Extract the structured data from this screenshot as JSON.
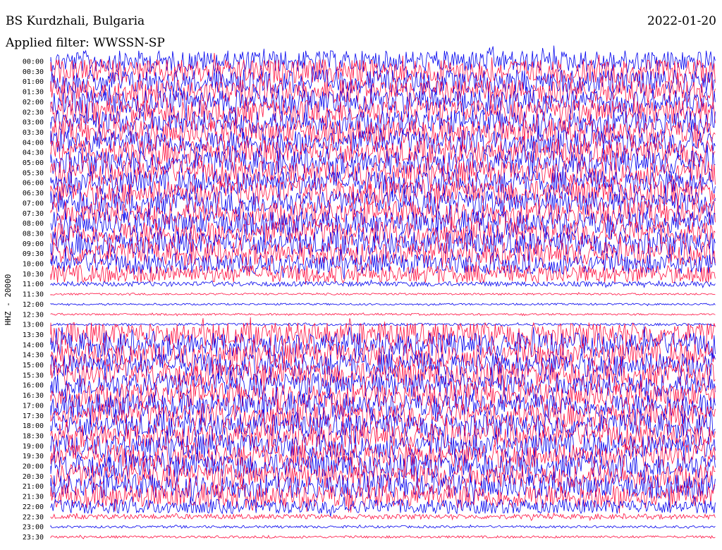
{
  "header": {
    "station": "BS Kurdzhali, Bulgaria",
    "date": "2022-01-20",
    "filter": "Applied filter: WWSSN-SP"
  },
  "chart_data": {
    "type": "line",
    "title": "BS Kurdzhali, Bulgaria",
    "subtitle": "Applied filter: WWSSN-SP",
    "ylabel": "HHZ - 20000",
    "xlabel": "",
    "colors": [
      "#0000ee",
      "#ff1040"
    ],
    "grid": false,
    "tick_labels": [
      "00:00",
      "00:30",
      "01:00",
      "01:30",
      "02:00",
      "02:30",
      "03:00",
      "03:30",
      "04:00",
      "04:30",
      "05:00",
      "05:30",
      "06:00",
      "06:30",
      "07:00",
      "07:30",
      "08:00",
      "08:30",
      "09:00",
      "09:30",
      "10:00",
      "10:30",
      "11:00",
      "11:30",
      "12:00",
      "12:30",
      "13:00",
      "13:30",
      "14:00",
      "14:30",
      "15:00",
      "15:30",
      "16:00",
      "16:30",
      "17:00",
      "17:30",
      "18:00",
      "18:30",
      "19:00",
      "19:30",
      "20:00",
      "20:30",
      "21:00",
      "21:30",
      "22:00",
      "22:30",
      "23:00",
      "23:30"
    ],
    "trace_amplitude": [
      0.9,
      1.0,
      1.0,
      1.0,
      1.0,
      1.0,
      1.0,
      1.0,
      1.0,
      1.0,
      1.0,
      1.0,
      1.0,
      1.0,
      1.0,
      1.0,
      1.0,
      1.0,
      1.0,
      0.95,
      0.85,
      0.75,
      0.2,
      0.08,
      0.08,
      0.08,
      0.1,
      1.0,
      1.0,
      1.0,
      1.0,
      1.0,
      1.0,
      1.0,
      1.0,
      1.0,
      1.0,
      1.0,
      1.0,
      1.0,
      1.0,
      1.0,
      1.0,
      1.0,
      0.6,
      0.2,
      0.1,
      0.1
    ]
  }
}
